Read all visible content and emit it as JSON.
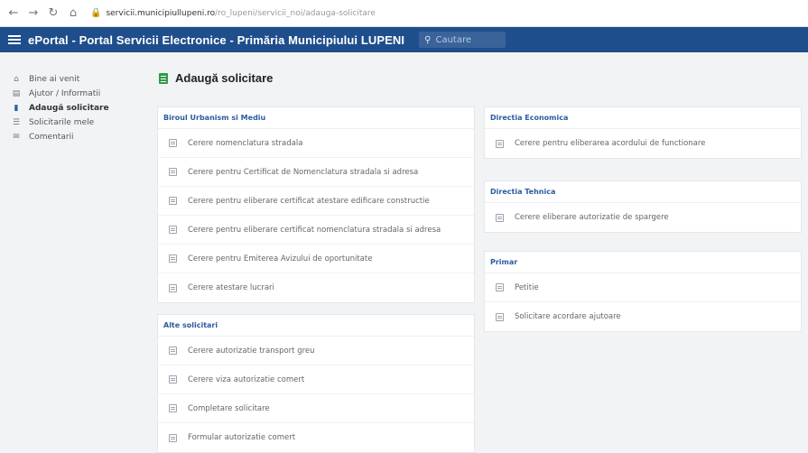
{
  "browser": {
    "url_host": "servicii.municipiullupeni.ro",
    "url_path": "/ro_lupeni/servicii_noi/adauga-solicitare"
  },
  "app": {
    "title": "ePortal - Portal Servicii Electronice - Primăria Municipiului LUPENI",
    "search_placeholder": "Cautare"
  },
  "sidebar": {
    "items": [
      {
        "label": "Bine ai venit",
        "icon": "home-icon",
        "active": false
      },
      {
        "label": "Ajutor / Informatii",
        "icon": "info-icon",
        "active": false
      },
      {
        "label": "Adaugă solicitare",
        "icon": "document-icon",
        "active": true
      },
      {
        "label": "Solicitarile mele",
        "icon": "list-icon",
        "active": false
      },
      {
        "label": "Comentarii",
        "icon": "chat-icon",
        "active": false
      }
    ]
  },
  "page": {
    "title": "Adaugă solicitare"
  },
  "cards": {
    "urbanism": {
      "title": "Biroul Urbanism si Mediu",
      "items": [
        "Cerere nomenclatura stradala",
        "Cerere pentru Certificat de Nomenclatura stradala si adresa",
        "Cerere pentru eliberare certificat atestare edificare constructie",
        "Cerere pentru eliberare certificat nomenclatura stradala si adresa",
        "Cerere pentru Emiterea Avizului de oportunitate",
        "Cerere atestare lucrari"
      ]
    },
    "alte": {
      "title": "Alte solicitari",
      "items": [
        "Cerere autorizatie transport greu",
        "Cerere viza autorizatie comert",
        "Completare solicitare",
        "Formular autorizatie comert"
      ]
    },
    "economica": {
      "title": "Directia Economica",
      "items": [
        "Cerere pentru eliberarea acordului de functionare"
      ]
    },
    "tehnica": {
      "title": "Directia Tehnica",
      "items": [
        "Cerere eliberare autorizatie de spargere"
      ]
    },
    "primar": {
      "title": "Primar",
      "items": [
        "Petitie",
        "Solicitare acordare ajutoare"
      ]
    }
  },
  "colors": {
    "appbar": "#1f4e8c",
    "card_title": "#2a5ca0",
    "page_icon": "#2e9b4a"
  }
}
